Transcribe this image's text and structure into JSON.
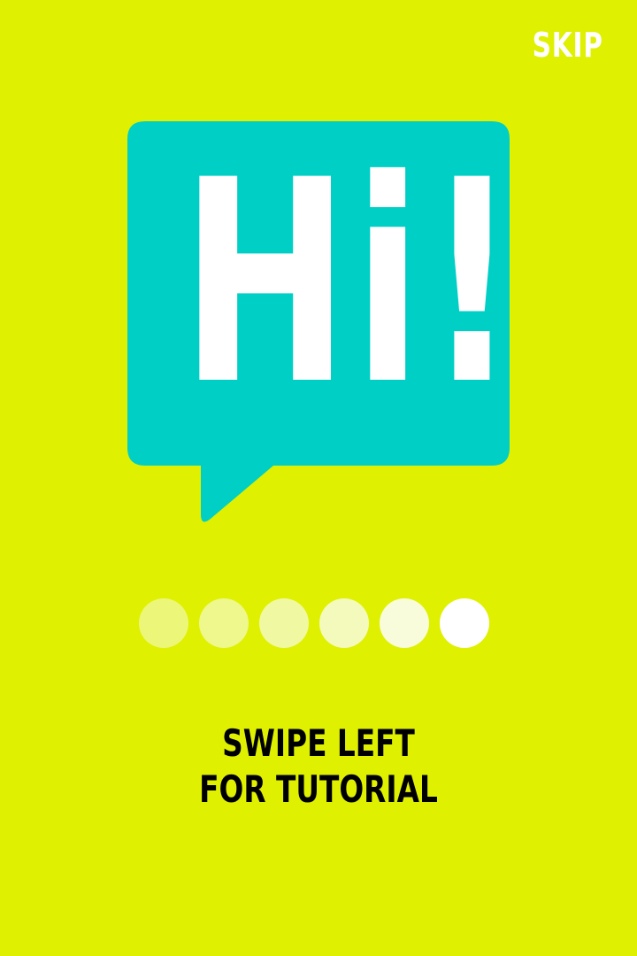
{
  "header": {
    "skip_label": "SKIP"
  },
  "bubble": {
    "text": "Hi!",
    "color": "#00CFC6",
    "text_color": "#FFFFFF"
  },
  "pager": {
    "total": 6,
    "current": 6,
    "dots": [
      {
        "color": "#ECF77A",
        "active": false
      },
      {
        "color": "#EEF88C",
        "active": false
      },
      {
        "color": "#F0F9A2",
        "active": false
      },
      {
        "color": "#F4FABC",
        "active": false
      },
      {
        "color": "#F8FCDA",
        "active": false
      },
      {
        "color": "#FFFFFF",
        "active": true
      }
    ]
  },
  "instructions": {
    "line1": "SWIPE LEFT",
    "line2": "FOR TUTORIAL"
  },
  "colors": {
    "background": "#DFF000",
    "skip": "#FFFFFF",
    "instruction_text": "#000000"
  }
}
